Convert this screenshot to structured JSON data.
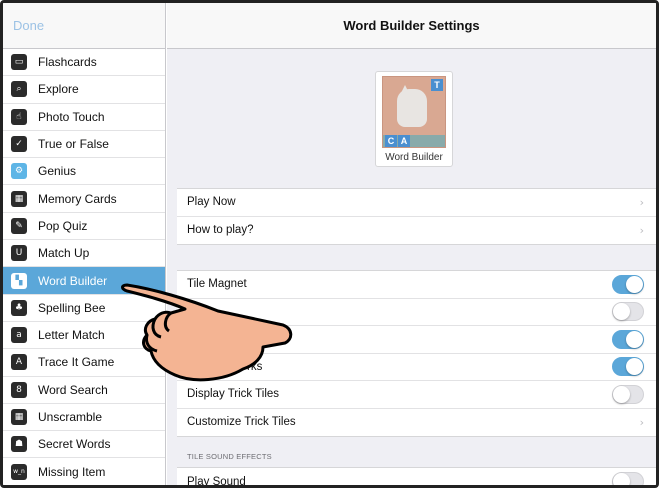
{
  "sidebar": {
    "done_label": "Done",
    "items": [
      {
        "label": "Flashcards",
        "icon": "flashcards-icon",
        "glyph": "▭"
      },
      {
        "label": "Explore",
        "icon": "explore-icon",
        "glyph": "⌕"
      },
      {
        "label": "Photo Touch",
        "icon": "photo-touch-icon",
        "glyph": "☝"
      },
      {
        "label": "True or False",
        "icon": "true-false-icon",
        "glyph": "✓"
      },
      {
        "label": "Genius",
        "icon": "genius-icon",
        "glyph": "⚙"
      },
      {
        "label": "Memory Cards",
        "icon": "memory-cards-icon",
        "glyph": "▦"
      },
      {
        "label": "Pop Quiz",
        "icon": "pop-quiz-icon",
        "glyph": "✎"
      },
      {
        "label": "Match Up",
        "icon": "match-up-icon",
        "glyph": "U"
      },
      {
        "label": "Word Builder",
        "icon": "word-builder-icon",
        "glyph": "▚"
      },
      {
        "label": "Spelling Bee",
        "icon": "spelling-bee-icon",
        "glyph": "♣"
      },
      {
        "label": "Letter Match",
        "icon": "letter-match-icon",
        "glyph": "a"
      },
      {
        "label": "Trace It Game",
        "icon": "trace-it-icon",
        "glyph": "A"
      },
      {
        "label": "Word Search",
        "icon": "word-search-icon",
        "glyph": "8"
      },
      {
        "label": "Unscramble",
        "icon": "unscramble-icon",
        "glyph": "▦"
      },
      {
        "label": "Secret Words",
        "icon": "secret-words-icon",
        "glyph": "☗"
      },
      {
        "label": "Missing Item",
        "icon": "missing-item-icon",
        "glyph": "w_n"
      }
    ],
    "active_index": 8
  },
  "main": {
    "title": "Word Builder Settings",
    "preview": {
      "caption": "Word Builder",
      "tile_t": "T",
      "tile_c": "C",
      "tile_a": "A"
    },
    "group1": [
      {
        "label": "Play Now",
        "type": "link"
      },
      {
        "label": "How to play?",
        "type": "link"
      }
    ],
    "group2": [
      {
        "label": "Tile Magnet",
        "type": "toggle",
        "on": true
      },
      {
        "label": "",
        "type": "toggle",
        "on": false
      },
      {
        "label": "",
        "type": "toggle",
        "on": true
      },
      {
        "label": "rks",
        "type": "toggle",
        "on": true
      },
      {
        "label": "Display Trick Tiles",
        "type": "toggle",
        "on": false
      },
      {
        "label": "Customize Trick Tiles",
        "type": "link"
      }
    ],
    "section_label": "TILE SOUND EFFECTS",
    "group3": [
      {
        "label": "Play Sound",
        "type": "toggle",
        "on": false
      }
    ]
  },
  "colors": {
    "accent": "#5ba7d9",
    "done_text": "#9cc2e5",
    "hand_fill": "#f4b493"
  }
}
